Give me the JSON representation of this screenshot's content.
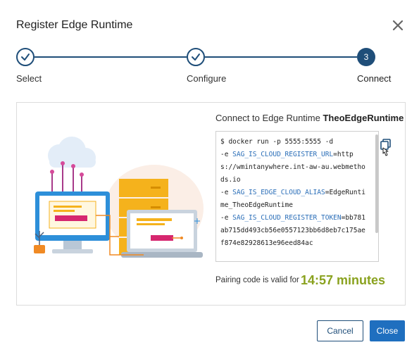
{
  "dialog": {
    "title": "Register Edge Runtime"
  },
  "stepper": {
    "steps": [
      {
        "label": "Select",
        "state": "done"
      },
      {
        "label": "Configure",
        "state": "done"
      },
      {
        "label": "Connect",
        "state": "active",
        "number": "3"
      }
    ]
  },
  "connect": {
    "title_prefix": "Connect to Edge Runtime ",
    "runtime_name": "TheoEdgeRuntime",
    "code_lines": [
      {
        "text": "$ docker run -p 5555:5555 -d",
        "type": "plain"
      },
      {
        "prefix": "-e ",
        "var": "SAG_IS_CLOUD_REGISTER_URL",
        "suffix": "=https://wmintanywhere.int-aw-au.webmethods.io"
      },
      {
        "prefix": "-e ",
        "var": "SAG_IS_EDGE_CLOUD_ALIAS",
        "suffix": "=EdgeRuntime_TheoEdgeRuntime"
      },
      {
        "prefix": "-e ",
        "var": "SAG_IS_CLOUD_REGISTER_TOKEN",
        "suffix": "=bb781ab715dd493cb56e0557123bb6d8eb7c175aef874e82928613e96eed84ac"
      }
    ],
    "pairing_label": "Pairing code is valid for",
    "pairing_time": "14:57 minutes"
  },
  "footer": {
    "cancel_label": "Cancel",
    "close_label": "Close"
  },
  "colors": {
    "primary": "#1f4e79",
    "button_primary": "#1f6fbf",
    "timer": "#8aa21f",
    "code_var": "#2a6eb8"
  }
}
